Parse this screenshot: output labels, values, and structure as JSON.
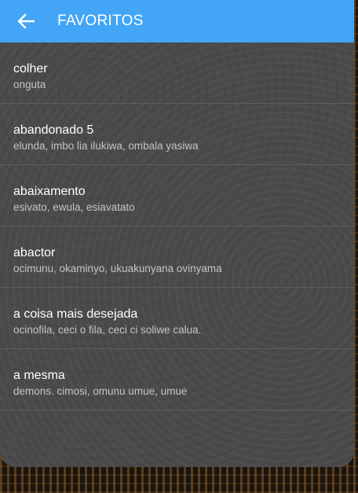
{
  "app_bar": {
    "title": "FAVORITOS",
    "back_icon": "arrow-left-icon",
    "color": "#42a5f5"
  },
  "favorites": [
    {
      "word": "colher",
      "translation": "onguta"
    },
    {
      "word": "abandonado 5",
      "translation": "elunda, imbo lia ilukiwa, ombala yasiwa"
    },
    {
      "word": "abaixamento",
      "translation": "esivato, ewula, esiavatato"
    },
    {
      "word": "abactor",
      "translation": "ocimunu, okaminyo, ukuakunyana ovinyama"
    },
    {
      "word": "a coisa mais desejada",
      "translation": "ocinofila, ceci o fila, ceci ci soliwe calua."
    },
    {
      "word": "a mesma",
      "translation": "demons. cimosi, omunu umue, umue"
    }
  ]
}
